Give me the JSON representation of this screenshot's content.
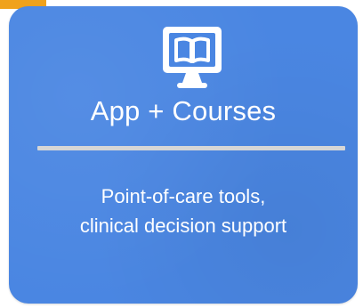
{
  "card": {
    "title": "App + Courses",
    "description_lines": [
      "Point-of-care tools,",
      "clinical decision support"
    ],
    "icon": "monitor-book-icon"
  },
  "colors": {
    "card_background": "#4a86e2",
    "corner_accent": "#f0a21c",
    "divider": "#d6d6d6",
    "text": "#ffffff"
  }
}
